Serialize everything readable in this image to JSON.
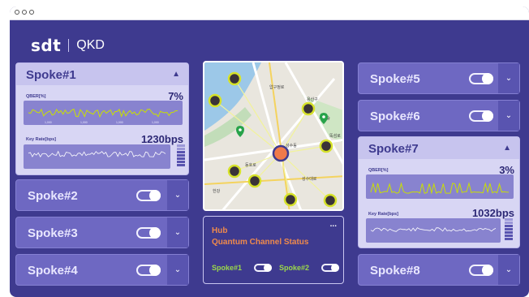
{
  "app": {
    "name": "QKD",
    "logo_text": "sdt"
  },
  "colors": {
    "accent": "#3e3a8f",
    "panel": "#6e68c2",
    "expanded": "#d8d6f4",
    "line": "#c9e000",
    "hub_text": "#f08a4b",
    "status_green": "#9bd84a"
  },
  "left_panels": [
    {
      "name": "Spoke#1",
      "expanded": true,
      "qber_label": "QBER[%]",
      "qber_value": "7%",
      "key_label": "Key Rate[bps]",
      "key_value": "1230bps",
      "toggle_on": true
    },
    {
      "name": "Spoke#2",
      "expanded": false,
      "toggle_on": true
    },
    {
      "name": "Spoke#3",
      "expanded": false,
      "toggle_on": true
    },
    {
      "name": "Spoke#4",
      "expanded": false,
      "toggle_on": true
    }
  ],
  "right_panels": [
    {
      "name": "Spoke#5",
      "expanded": false,
      "toggle_on": true
    },
    {
      "name": "Spoke#6",
      "expanded": false,
      "toggle_on": true
    },
    {
      "name": "Spoke#7",
      "expanded": true,
      "qber_label": "QBER[%]",
      "qber_value": "3%",
      "key_label": "Key Rate[bps]",
      "key_value": "1032bps",
      "toggle_on": true
    },
    {
      "name": "Spoke#8",
      "expanded": false,
      "toggle_on": true
    }
  ],
  "map": {
    "labels": [
      "용산구",
      "성수동",
      "서울숲",
      "뚝섬로",
      "한강",
      "동호로",
      "압구정로",
      "성수대로"
    ],
    "icons": [
      "pin-icon",
      "location-icon"
    ]
  },
  "hub": {
    "title": "Hub",
    "subtitle": "Quantum Channel Status",
    "menu": "...",
    "statuses": [
      {
        "name": "Spoke#1",
        "on": true
      },
      {
        "name": "Spoke#2",
        "on": true
      }
    ]
  }
}
